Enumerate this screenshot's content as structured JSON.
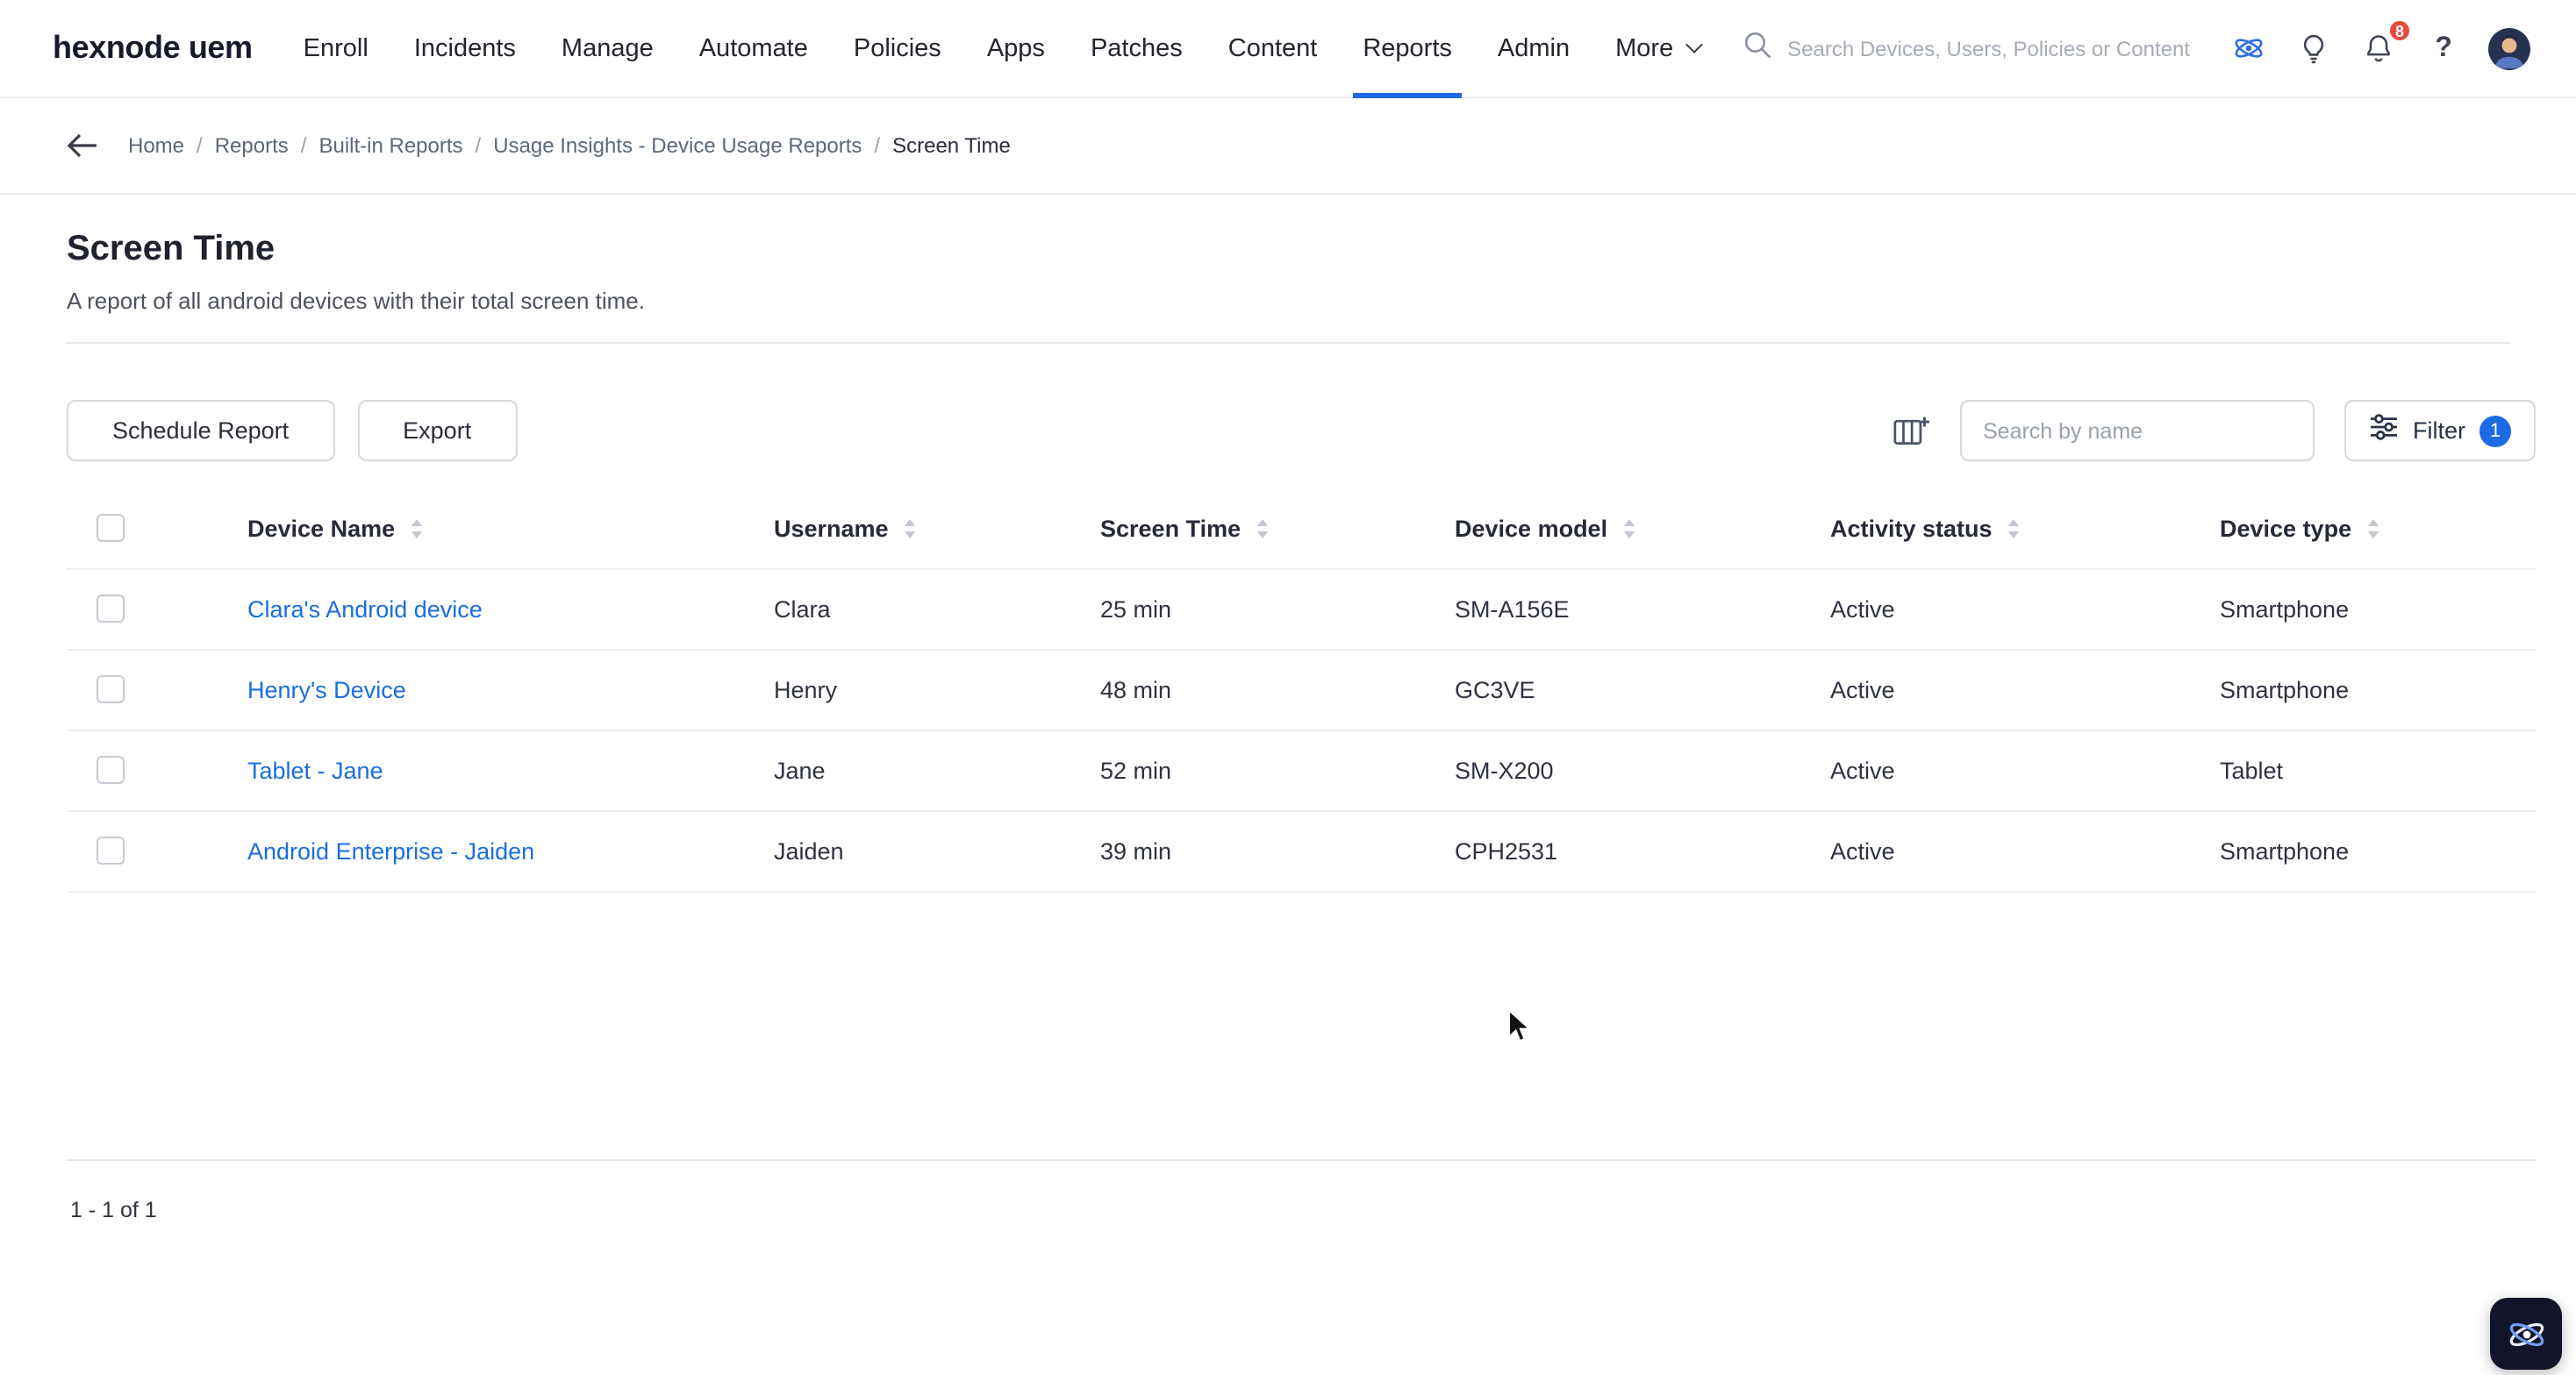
{
  "brand": {
    "logo": "hexnode uem"
  },
  "nav": {
    "items": [
      "Enroll",
      "Incidents",
      "Manage",
      "Automate",
      "Policies",
      "Apps",
      "Patches",
      "Content",
      "Reports",
      "Admin",
      "More"
    ],
    "active": "Reports",
    "search_placeholder": "Search Devices, Users, Policies or Content",
    "notification_count": "8",
    "help_glyph": "?"
  },
  "breadcrumb": {
    "sep": "/",
    "items": [
      "Home",
      "Reports",
      "Built-in Reports",
      "Usage Insights - Device Usage Reports",
      "Screen Time"
    ]
  },
  "page": {
    "title": "Screen Time",
    "subtitle": "A report of all android devices with their total screen time."
  },
  "toolbar": {
    "schedule_button": "Schedule Report",
    "export_button": "Export",
    "search_placeholder": "Search by name",
    "filter_label": "Filter",
    "filter_count": "1"
  },
  "table": {
    "columns": [
      "Device Name",
      "Username",
      "Screen Time",
      "Device model",
      "Activity status",
      "Device type"
    ],
    "rows": [
      {
        "device_name": "Clara's Android device",
        "username": "Clara",
        "screen_time": "25 min",
        "device_model": "SM-A156E",
        "activity_status": "Active",
        "device_type": "Smartphone"
      },
      {
        "device_name": "Henry's Device",
        "username": "Henry",
        "screen_time": "48 min",
        "device_model": "GC3VE",
        "activity_status": "Active",
        "device_type": "Smartphone"
      },
      {
        "device_name": "Tablet - Jane",
        "username": "Jane",
        "screen_time": "52 min",
        "device_model": "SM-X200",
        "activity_status": "Active",
        "device_type": "Tablet"
      },
      {
        "device_name": "Android Enterprise - Jaiden",
        "username": "Jaiden",
        "screen_time": "39 min",
        "device_model": "CPH2531",
        "activity_status": "Active",
        "device_type": "Smartphone"
      }
    ]
  },
  "pagination": {
    "summary": "1 - 1 of 1"
  },
  "colors": {
    "accent": "#1d6ae5",
    "link": "#1a6ee0",
    "notification_badge": "#e8483f"
  }
}
